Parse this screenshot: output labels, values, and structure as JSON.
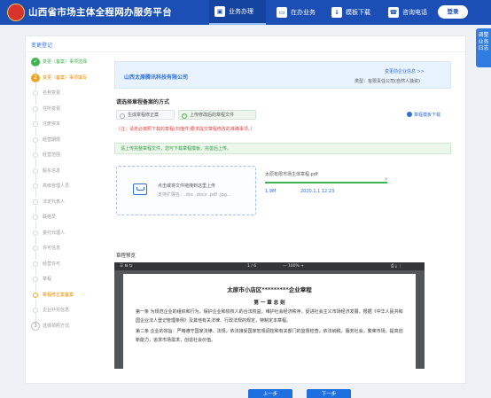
{
  "header": {
    "site_title": "山西省市场主体全程网办服务平台",
    "nav": [
      {
        "label": "业务办理",
        "icon": "briefcase-icon",
        "active": true
      },
      {
        "label": "在办业务",
        "icon": "monitor-icon",
        "active": false
      },
      {
        "label": "模板下载",
        "icon": "download-icon",
        "active": false
      },
      {
        "label": "咨询电话",
        "icon": "phone-icon",
        "active": false
      }
    ],
    "login_label": "登录"
  },
  "side_tab": {
    "label": "调整业务日志"
  },
  "card": {
    "title": "变更登记"
  },
  "steps": [
    {
      "label": "变更（备案）事项选择",
      "state": "done",
      "mark": "✓"
    },
    {
      "label": "变更（备案）事项填写",
      "state": "current",
      "mark": "2"
    },
    {
      "label": "名称变更",
      "state": "sub"
    },
    {
      "label": "住所变更",
      "state": "sub"
    },
    {
      "label": "注册资本",
      "state": "sub"
    },
    {
      "label": "经营期限",
      "state": "sub"
    },
    {
      "label": "经营范围",
      "state": "sub"
    },
    {
      "label": "股东信息",
      "state": "sub"
    },
    {
      "label": "高级管理人员",
      "state": "sub"
    },
    {
      "label": "法定代表人",
      "state": "sub"
    },
    {
      "label": "联络员",
      "state": "sub"
    },
    {
      "label": "委托代理人",
      "state": "sub"
    },
    {
      "label": "许可信息",
      "state": "sub"
    },
    {
      "label": "经营许可",
      "state": "sub"
    },
    {
      "label": "章程",
      "state": "sub"
    },
    {
      "label": "章程修正案备案",
      "state": "active-sub"
    },
    {
      "label": "企业补充信息",
      "state": "sub"
    },
    {
      "label": "选择领照方式",
      "state": "circle",
      "mark": "3"
    }
  ],
  "company": {
    "name": "山西太原腾讯科技有限公司",
    "change_info_link": "变更前企业信息 >>",
    "type": "类型：有限责任公司(自然人独资)"
  },
  "filing": {
    "heading": "请选择章程备案的方式",
    "options": [
      {
        "label": "生成章程修正案",
        "selected": false
      },
      {
        "label": "上传修改后的章程文件",
        "selected": true
      }
    ],
    "download_link": "章程模板下载",
    "note": "（注：请务必按照下载的章程(扫描件)要求提交章程修改的准确事项。）",
    "tip": "请上传完整章程文件，您可下载章程模板，完善后上传。"
  },
  "upload": {
    "prompt": "点击或将文件拖拽到这里上传",
    "types": "支持扩展名：.doc .docx .pdf .jpg..."
  },
  "file": {
    "name": "太原有限市场主体章程.pdf",
    "size": "1.9M",
    "date": "2020.1.1 12:23",
    "progress": 1.0
  },
  "preview": {
    "label": "章程预览",
    "toolbar": {
      "left": "☰  ⊟  ⇆",
      "page": "1 / 6",
      "zoom": "— 100% +",
      "tools": "⎙  ⤓  ⋮"
    },
    "doc": {
      "title": "太原市小店区*********企业章程",
      "chapter": "第 一 章  总 则",
      "paragraphs": [
        "第一条 为规范企业的组织和行为，保护企业和债权人的合法权益，维护社会经济秩序，促进社会主义市场经济发展，根据《中华人民共和国企业法人登记管理条例》及其他有关法律、行政法规的规定，特制定本章程。",
        "第二条 企业的宗旨：严格遵守国家法律、法规，依法接受国家宏观调控和有关部门的监督检查，依法纳税，服务社会，繁荣市场，提高创新能力，追求市场需求，创造社会价值。"
      ]
    }
  },
  "buttons": {
    "prev": "上一步",
    "next": "下一步"
  }
}
